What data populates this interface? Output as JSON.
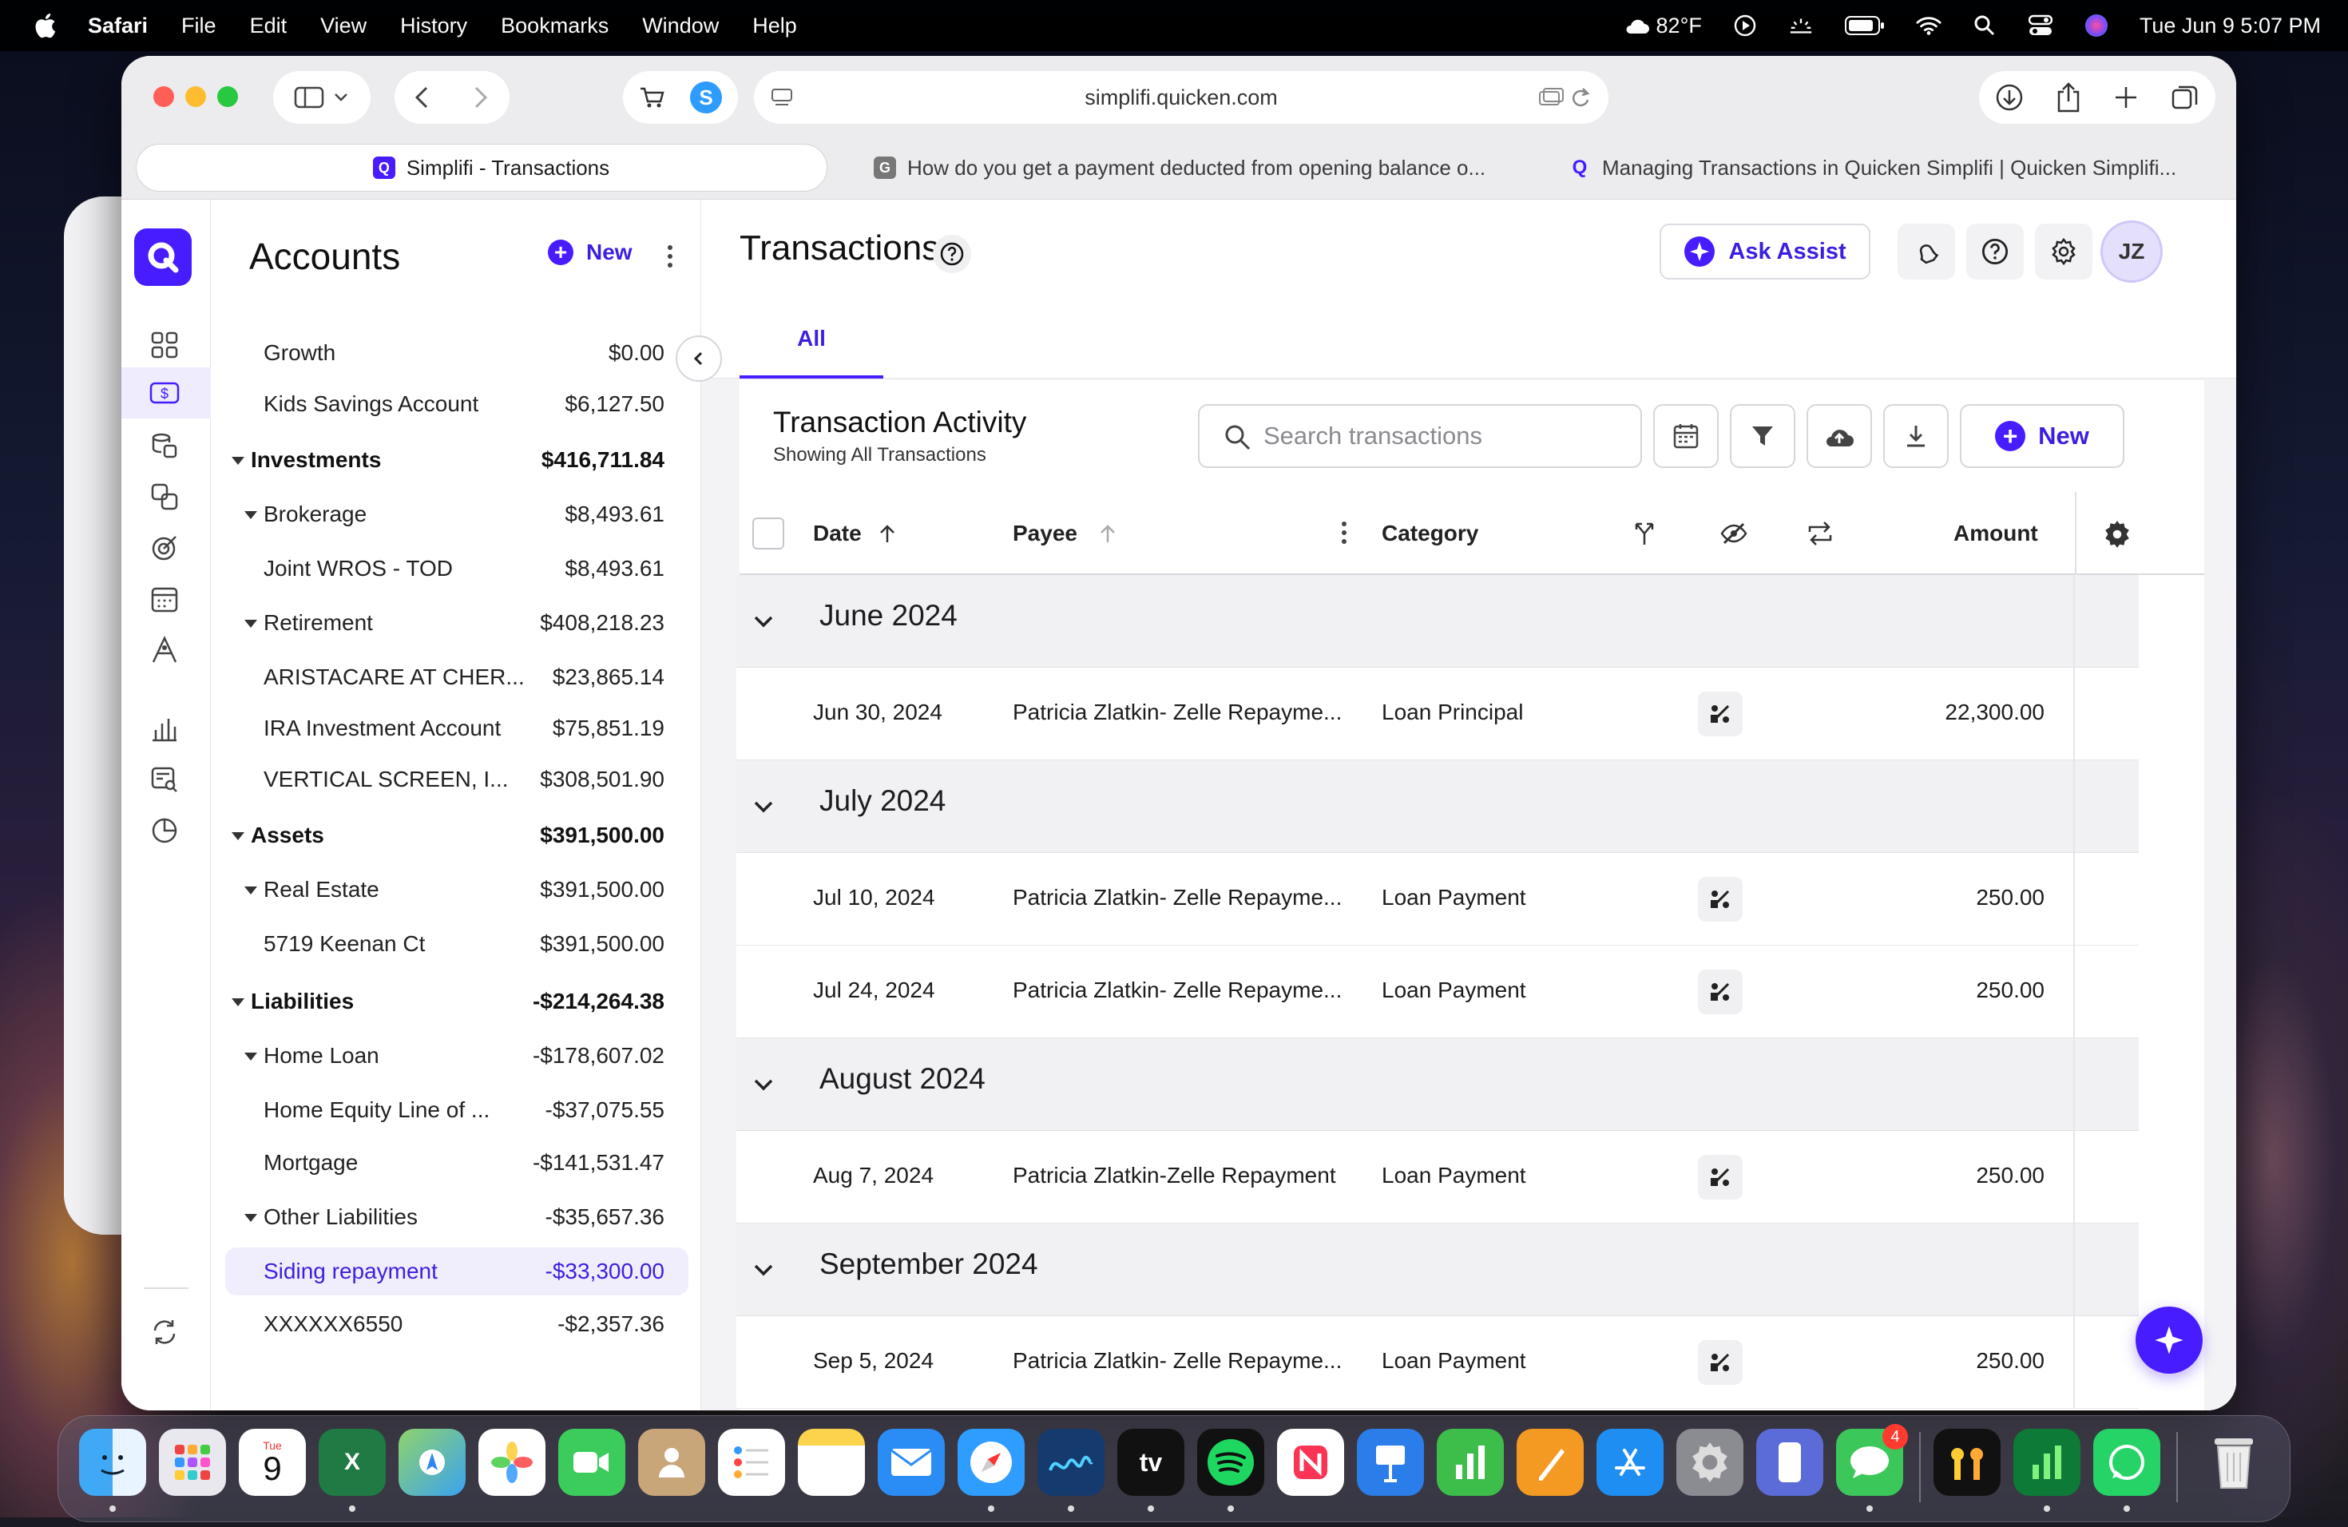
{
  "menubar": {
    "app": "Safari",
    "items": [
      "File",
      "Edit",
      "View",
      "History",
      "Bookmarks",
      "Window",
      "Help"
    ],
    "weather": "82°F",
    "datetime": "Tue Jun 9  5:07 PM"
  },
  "browser": {
    "url": "simplifi.quicken.com",
    "tabs": [
      {
        "title": "Simplifi - Transactions",
        "icon": "quicken-q-icon"
      },
      {
        "title": "How do you get a payment deducted from opening balance o...",
        "icon": "g-icon"
      },
      {
        "title": "Managing Transactions in Quicken Simplifi | Quicken Simplifi...",
        "icon": "quicken-q-icon"
      }
    ]
  },
  "accounts": {
    "title": "Accounts",
    "new_label": "New",
    "rows": [
      {
        "name": "Growth",
        "value": "$0.00",
        "level": "child"
      },
      {
        "name": "Kids Savings Account",
        "value": "$6,127.50",
        "level": "child"
      },
      {
        "name": "Investments",
        "value": "$416,711.84",
        "level": "group"
      },
      {
        "name": "Brokerage",
        "value": "$8,493.61",
        "level": "sub"
      },
      {
        "name": "Joint WROS - TOD",
        "value": "$8,493.61",
        "level": "child"
      },
      {
        "name": "Retirement",
        "value": "$408,218.23",
        "level": "sub"
      },
      {
        "name": "ARISTACARE AT CHER...",
        "value": "$23,865.14",
        "level": "child"
      },
      {
        "name": "IRA Investment Account",
        "value": "$75,851.19",
        "level": "child"
      },
      {
        "name": "VERTICAL SCREEN, I...",
        "value": "$308,501.90",
        "level": "child"
      },
      {
        "name": "Assets",
        "value": "$391,500.00",
        "level": "group"
      },
      {
        "name": "Real Estate",
        "value": "$391,500.00",
        "level": "sub"
      },
      {
        "name": "5719 Keenan Ct",
        "value": "$391,500.00",
        "level": "child"
      },
      {
        "name": "Liabilities",
        "value": "-$214,264.38",
        "level": "group"
      },
      {
        "name": "Home Loan",
        "value": "-$178,607.02",
        "level": "sub"
      },
      {
        "name": "Home Equity Line of ...",
        "value": "-$37,075.55",
        "level": "child"
      },
      {
        "name": "Mortgage",
        "value": "-$141,531.47",
        "level": "child"
      },
      {
        "name": "Other Liabilities",
        "value": "-$35,657.36",
        "level": "sub"
      },
      {
        "name": "Siding repayment",
        "value": "-$33,300.00",
        "level": "selected"
      },
      {
        "name": "XXXXXX6550",
        "value": "-$2,357.36",
        "level": "child"
      }
    ]
  },
  "main": {
    "title": "Transactions",
    "ask_assist": "Ask Assist",
    "avatar": "JZ",
    "tab_all": "All",
    "activity_title": "Transaction Activity",
    "activity_sub": "Showing All Transactions",
    "search_placeholder": "Search transactions",
    "new_label": "New",
    "columns": {
      "date": "Date",
      "payee": "Payee",
      "category": "Category",
      "amount": "Amount"
    },
    "groups": [
      {
        "month": "June 2024",
        "rows": [
          {
            "date": "Jun 30, 2024",
            "payee": "Patricia Zlatkin- Zelle Repayme...",
            "category": "Loan Principal",
            "amount": "22,300.00"
          }
        ]
      },
      {
        "month": "July 2024",
        "rows": [
          {
            "date": "Jul 10, 2024",
            "payee": "Patricia Zlatkin- Zelle Repayme...",
            "category": "Loan Payment",
            "amount": "250.00"
          },
          {
            "date": "Jul 24, 2024",
            "payee": "Patricia Zlatkin- Zelle Repayme...",
            "category": "Loan Payment",
            "amount": "250.00"
          }
        ]
      },
      {
        "month": "August 2024",
        "rows": [
          {
            "date": "Aug 7, 2024",
            "payee": "Patricia Zlatkin-Zelle Repayment",
            "category": "Loan Payment",
            "amount": "250.00"
          }
        ]
      },
      {
        "month": "September 2024",
        "rows": [
          {
            "date": "Sep 5, 2024",
            "payee": "Patricia Zlatkin- Zelle Repayme...",
            "category": "Loan Payment",
            "amount": "250.00"
          }
        ]
      }
    ]
  },
  "dock": {
    "calendar_day": "Tue",
    "calendar_date": "9",
    "messages_badge": "4",
    "tv_label": "tv"
  },
  "colors": {
    "brand": "#471cff",
    "brand_text": "#3b1fe0"
  }
}
